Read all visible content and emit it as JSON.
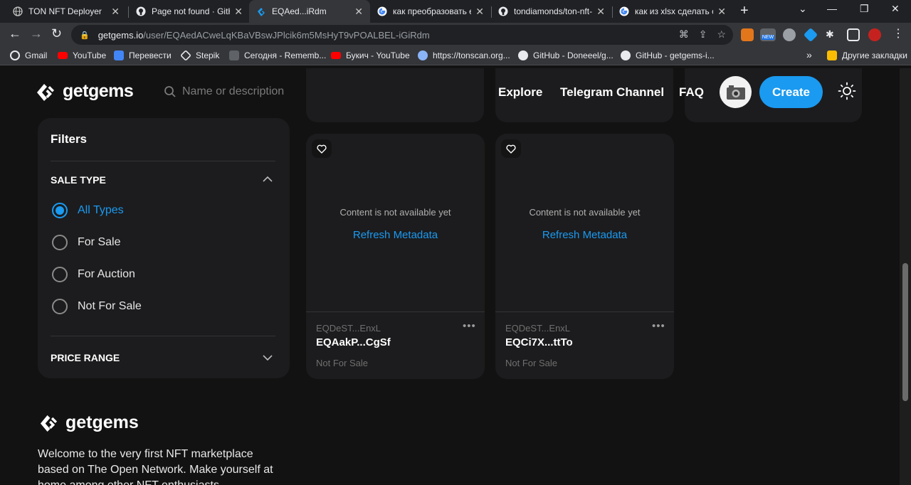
{
  "browser": {
    "tabs": [
      {
        "title": "TON NFT Deployer",
        "icon": "globe-icon"
      },
      {
        "title": "Page not found · GitHub",
        "icon": "github-icon"
      },
      {
        "title": "EQAed...iRdm",
        "icon": "getgems-icon",
        "active": true
      },
      {
        "title": "как преобразовать exc",
        "icon": "google-icon"
      },
      {
        "title": "tondiamonds/ton-nft-",
        "icon": "github-icon"
      },
      {
        "title": "как из xlsx сделать csv",
        "icon": "google-icon"
      }
    ],
    "url_host": "getgems.io",
    "url_path": "/user/EQAedACweLqKBaVBswJPlcik6m5MsHyT9vPOALBEL-iGiRdm",
    "extension_badge": "NEW",
    "bookmarks": [
      {
        "label": "Gmail",
        "icon": "google-icon",
        "color": "#e8eaed"
      },
      {
        "label": "YouTube",
        "icon": "youtube-icon",
        "color": "#ff0000"
      },
      {
        "label": "Перевести",
        "icon": "translate-icon",
        "color": "#4285f4"
      },
      {
        "label": "Stepik",
        "icon": "stepik-icon",
        "color": "#e8eaed"
      },
      {
        "label": "Сегодня - Rememb...",
        "icon": "remember-icon",
        "color": "#e8eaed"
      },
      {
        "label": "Букич - YouTube",
        "icon": "youtube-icon",
        "color": "#ff0000"
      },
      {
        "label": "https://tonscan.org...",
        "icon": "tonscan-icon",
        "color": "#8ab4f8"
      },
      {
        "label": "GitHub - Doneeel/g...",
        "icon": "github-icon",
        "color": "#e8eaed"
      },
      {
        "label": "GitHub - getgems-i...",
        "icon": "github-icon",
        "color": "#e8eaed"
      }
    ],
    "other_bookmarks": "Другие закладки",
    "overflow": "»"
  },
  "header": {
    "logo": "getgems",
    "search_placeholder": "Name or description",
    "nav": [
      "Explore",
      "Telegram Channel",
      "FAQ"
    ],
    "create_label": "Create"
  },
  "filters": {
    "title": "Filters",
    "sale_type_title": "SALE TYPE",
    "options": [
      {
        "label": "All Types",
        "selected": true
      },
      {
        "label": "For Sale",
        "selected": false
      },
      {
        "label": "For Auction",
        "selected": false
      },
      {
        "label": "Not For Sale",
        "selected": false
      }
    ],
    "price_range_title": "PRICE RANGE"
  },
  "nfts": [
    {
      "placeholder": "Content is not available yet",
      "refresh": "Refresh Metadata",
      "collection": "EQDeST...EnxL",
      "name": "EQAakP...CgSf",
      "status": "Not For Sale"
    },
    {
      "placeholder": "Content is not available yet",
      "refresh": "Refresh Metadata",
      "collection": "EQDeST...EnxL",
      "name": "EQCi7X...ttTo",
      "status": "Not For Sale"
    }
  ],
  "footer": {
    "logo": "getgems",
    "text": "Welcome to the very first NFT marketplace based on The Open Network. Make yourself at home among other NFT enthusiasts."
  },
  "colors": {
    "accent": "#1a9af0",
    "page_bg": "#121212",
    "card_bg": "#1c1c1e"
  }
}
